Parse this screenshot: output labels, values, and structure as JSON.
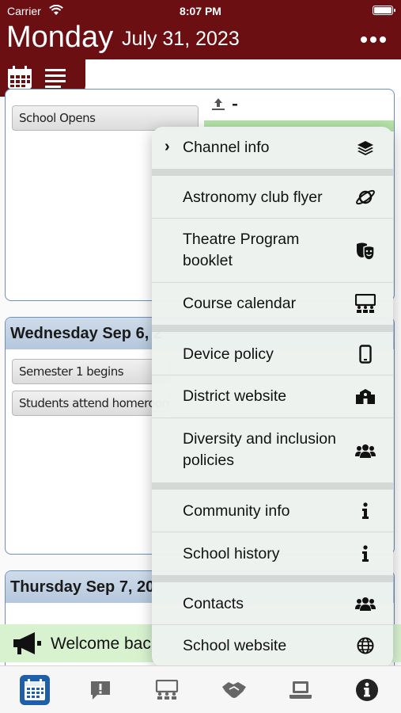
{
  "status": {
    "carrier": "Carrier",
    "time": "8:07 PM"
  },
  "header": {
    "day": "Monday",
    "date": "July 31, 2023"
  },
  "background": {
    "card1_event": "School Opens",
    "card2_title": "Wednesday Sep 6, 2",
    "card2_events": [
      "Semester 1 begins",
      "Students attend homeroom in"
    ],
    "card3_title": "Thursday Sep 7, 20",
    "welcome": "Welcome bac"
  },
  "menu": {
    "channel_info": "Channel info",
    "items": [
      "Astronomy club flyer",
      "Theatre Program booklet",
      "Course calendar",
      "Device policy",
      "District website",
      "Diversity and inclusion policies",
      "Community info",
      "School history",
      "Contacts",
      "School website"
    ]
  },
  "colors": {
    "brand": "#6b0f12",
    "accent": "#1f5fa8"
  }
}
